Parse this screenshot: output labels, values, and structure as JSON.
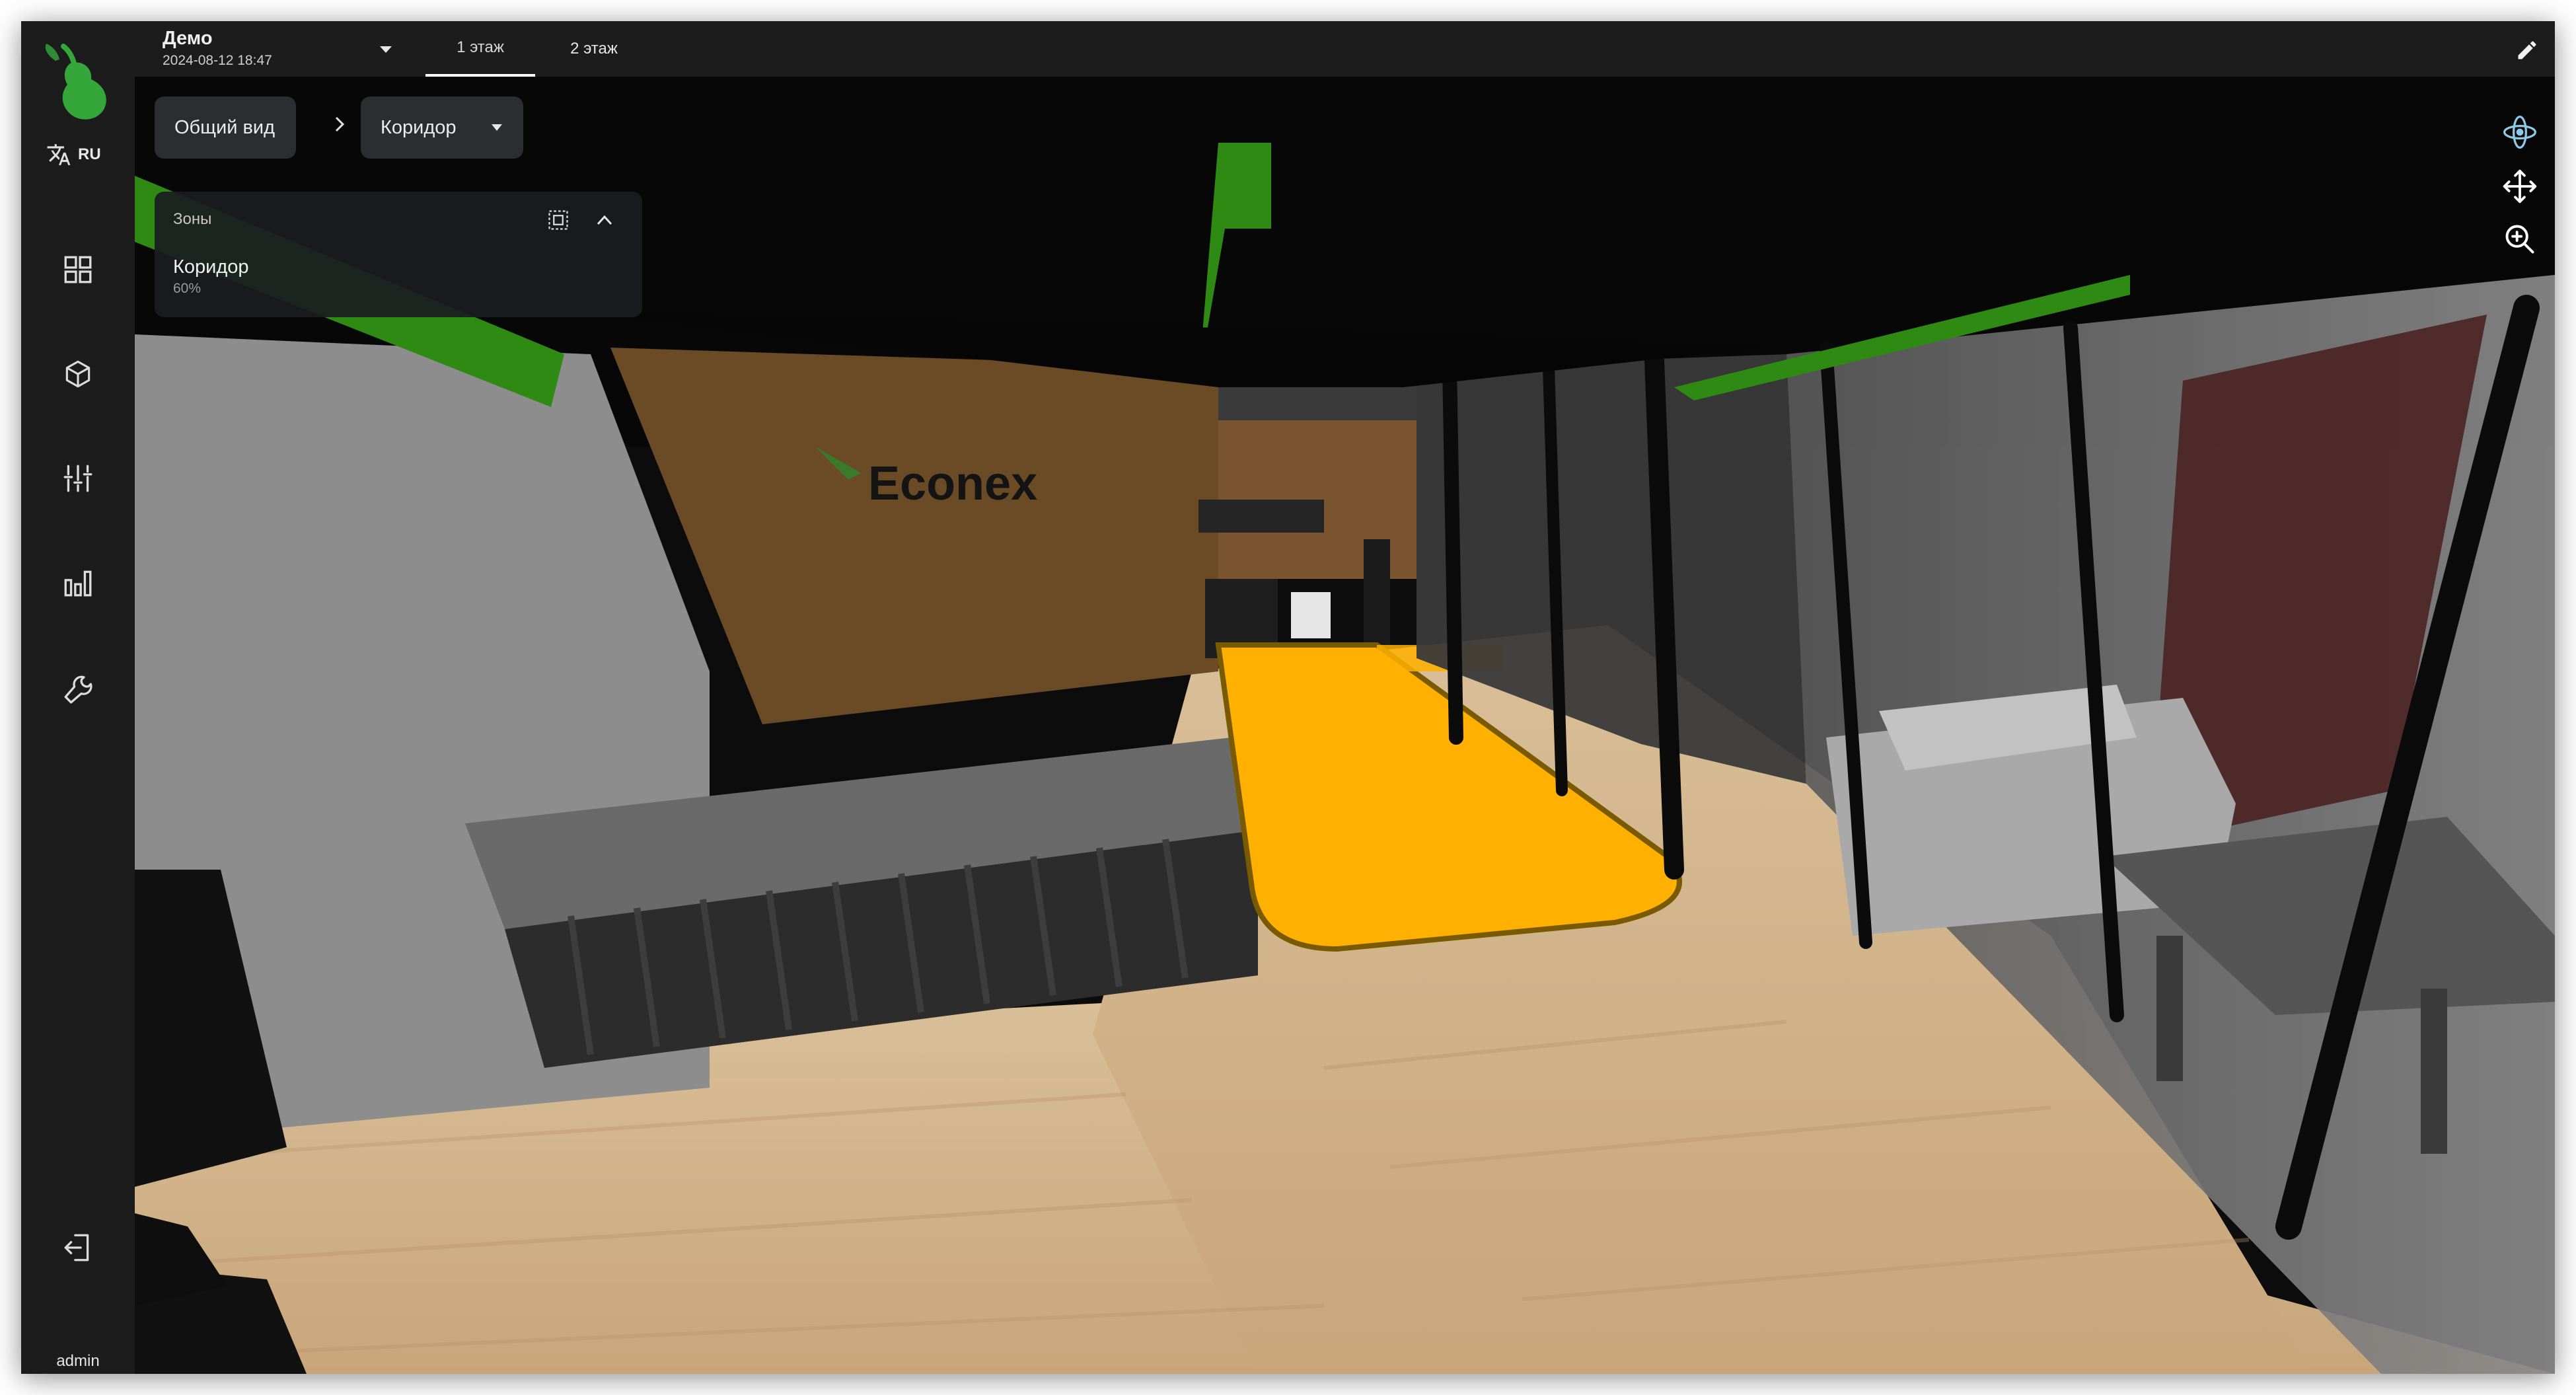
{
  "sidebar": {
    "lang_code": "RU",
    "user": "admin",
    "nav": [
      {
        "name": "dashboard-icon"
      },
      {
        "name": "cube-icon"
      },
      {
        "name": "sliders-icon"
      },
      {
        "name": "bar-chart-icon"
      },
      {
        "name": "wrench-icon"
      }
    ],
    "brand_color": "#35a63a"
  },
  "header": {
    "project": "Демо",
    "datetime": "2024-08-12 18:47",
    "floors": [
      "1 этаж",
      "2 этаж"
    ],
    "active_floor": "1 этаж"
  },
  "breadcrumb": {
    "root": "Общий вид",
    "current": "Коридор"
  },
  "zones": {
    "title": "Зоны",
    "items": [
      {
        "name": "Коридор",
        "percent": "60%"
      }
    ]
  },
  "scene": {
    "wall_logo": "Econex",
    "highlight_color": "#ffb000"
  }
}
